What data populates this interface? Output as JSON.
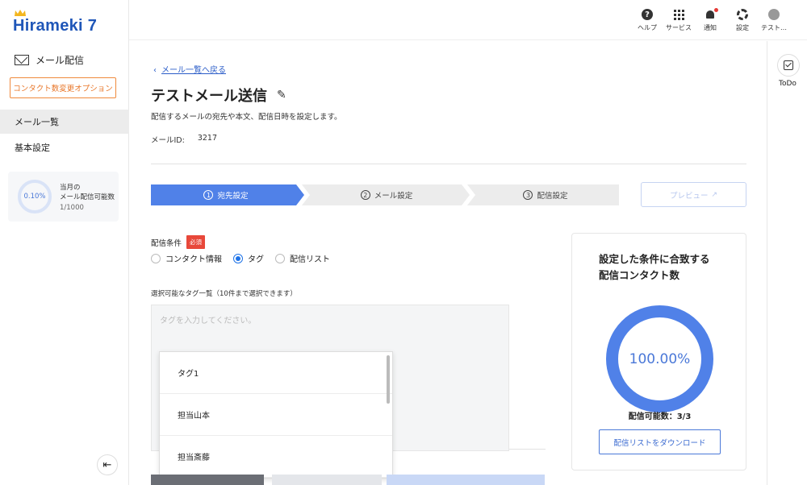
{
  "app": {
    "logo": "Hirameki 7"
  },
  "sidebar": {
    "section_title": "メール配信",
    "option_button": "コンタクト数変更オプション",
    "items": [
      {
        "label": "メール一覧",
        "active": true
      },
      {
        "label": "基本設定",
        "active": false
      }
    ],
    "quota": {
      "percent": "0.10%",
      "label_line1": "当月の",
      "label_line2": "メール配信可能数",
      "count": "1/1000"
    }
  },
  "topbar": {
    "items": [
      {
        "label": "ヘルプ",
        "icon": "help-icon"
      },
      {
        "label": "サービス",
        "icon": "grid-icon"
      },
      {
        "label": "通知",
        "icon": "bell-icon"
      },
      {
        "label": "設定",
        "icon": "gear-icon"
      },
      {
        "label": "テスト…",
        "icon": "user-icon"
      }
    ]
  },
  "main": {
    "back_link": "メール一覧へ戻る",
    "title": "テストメール送信",
    "description": "配信するメールの宛先や本文、配信日時を設定します。",
    "mail_id_label": "メールID:",
    "mail_id_value": "3217",
    "steps": [
      {
        "num": "1",
        "label": "宛先設定",
        "active": true
      },
      {
        "num": "2",
        "label": "メール設定",
        "active": false
      },
      {
        "num": "3",
        "label": "配信設定",
        "active": false
      }
    ],
    "preview_button": "プレビュー",
    "condition_label": "配信条件",
    "required_badge": "必須",
    "radios": [
      {
        "label": "コンタクト情報",
        "checked": false
      },
      {
        "label": "タグ",
        "checked": true
      },
      {
        "label": "配信リスト",
        "checked": false
      }
    ],
    "tag_list_label": "選択可能なタグ一覧（10件まで選択できます）",
    "tag_placeholder": "タグを入力してください。",
    "tag_options": [
      "タグ1",
      "担当山本",
      "担当斎藤"
    ]
  },
  "count_card": {
    "title_line1": "設定した条件に合致する",
    "title_line2": "配信コンタクト数",
    "percent": "100.00%",
    "available": "配信可能数：3/3",
    "download_button": "配信リストをダウンロード"
  },
  "rail": {
    "todo_label": "ToDo"
  },
  "colors": {
    "brand": "#1f56b8",
    "accent": "#5081e8",
    "step_active": "#5081e8",
    "step_inactive": "#ececec",
    "required": "#e8483a",
    "option_orange": "#f08a3c"
  }
}
